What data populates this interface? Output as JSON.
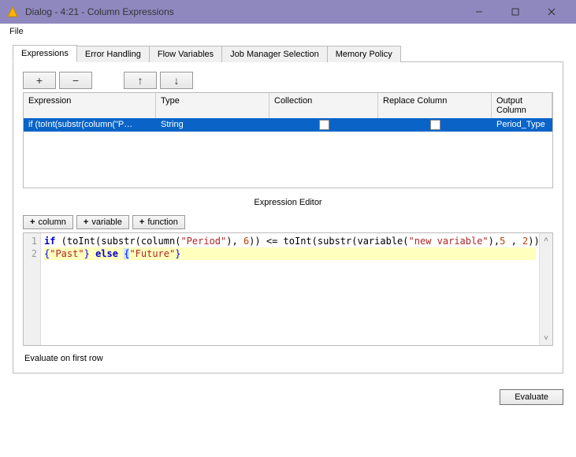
{
  "window": {
    "title": "Dialog - 4:21 - Column Expressions"
  },
  "menu": {
    "file": "File"
  },
  "tabs": [
    {
      "label": "Expressions"
    },
    {
      "label": "Error Handling"
    },
    {
      "label": "Flow Variables"
    },
    {
      "label": "Job Manager Selection"
    },
    {
      "label": "Memory Policy"
    }
  ],
  "table": {
    "headers": {
      "expression": "Expression",
      "type": "Type",
      "collection": "Collection",
      "replace": "Replace Column",
      "output": "Output Column"
    },
    "rows": [
      {
        "expression": "if (toInt(substr(column(\"P…",
        "type": "String",
        "collection": false,
        "replace": false,
        "output": "Period_Type"
      }
    ]
  },
  "editor": {
    "title": "Expression Editor",
    "buttons": {
      "column": "column",
      "variable": "variable",
      "function": "function"
    },
    "gutter": [
      "1",
      "2"
    ],
    "line1": {
      "kw_if": "if",
      "fn_toInt": "toInt",
      "fn_substr": "substr",
      "fn_column": "column",
      "str_period": "\"Period\"",
      "num_6": "6",
      "op": " <= ",
      "fn_variable": "variable",
      "str_newvar": "\"new variable\"",
      "num_5": "5",
      "num_2": "2"
    },
    "line2": {
      "str_past": "\"Past\"",
      "kw_else": "else",
      "str_future": "\"Future\""
    }
  },
  "eval_label": "Evaluate on first row",
  "evaluate_btn": "Evaluate"
}
